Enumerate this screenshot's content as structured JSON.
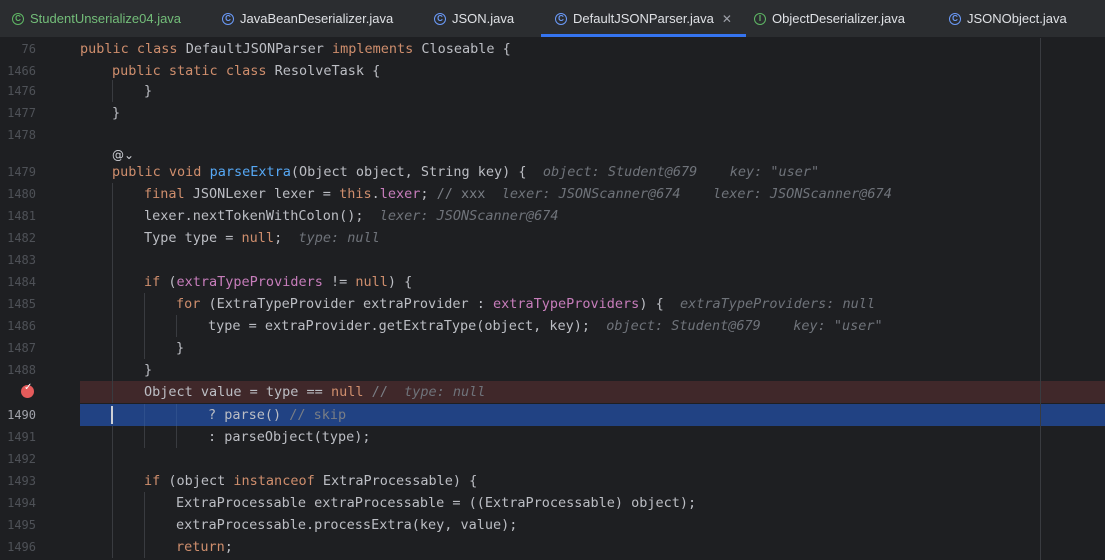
{
  "tabs": [
    {
      "label": "StudentUnserialize04.java",
      "icon": "class-run-icon",
      "active": false,
      "green": true
    },
    {
      "label": "JavaBeanDeserializer.java",
      "icon": "class-icon",
      "active": false
    },
    {
      "label": "JSON.java",
      "icon": "class-icon",
      "active": false
    },
    {
      "label": "DefaultJSONParser.java",
      "icon": "class-icon",
      "active": true,
      "close": "✕"
    },
    {
      "label": "ObjectDeserializer.java",
      "icon": "interface-icon",
      "active": false
    },
    {
      "label": "JSONObject.java",
      "icon": "class-icon",
      "active": false
    }
  ],
  "lines": [
    {
      "num": "76"
    },
    {
      "num": "1466"
    },
    {
      "num": "1476"
    },
    {
      "num": "1477"
    },
    {
      "num": "1478"
    },
    {
      "num": "1479"
    },
    {
      "num": "1480"
    },
    {
      "num": "1481"
    },
    {
      "num": "1482"
    },
    {
      "num": "1483"
    },
    {
      "num": "1484"
    },
    {
      "num": "1485"
    },
    {
      "num": "1486"
    },
    {
      "num": "1487"
    },
    {
      "num": "1488"
    },
    {
      "num": ""
    },
    {
      "num": "1490"
    },
    {
      "num": "1491"
    },
    {
      "num": "1492"
    },
    {
      "num": "1493"
    },
    {
      "num": "1494"
    },
    {
      "num": "1495"
    },
    {
      "num": "1496"
    }
  ],
  "code": {
    "l76": [
      "public",
      " ",
      "class",
      " DefaultJSONParser ",
      "implements",
      " Closeable {"
    ],
    "l1466": [
      "public",
      " ",
      "static",
      " ",
      "class",
      " ResolveTask {"
    ],
    "l1476": "}",
    "l1477": "}",
    "lens_icon": "@",
    "lens_chevron": "⌄",
    "l1479": {
      "kw1": "public",
      "kw2": "void",
      "fn": "parseExtra",
      "rest": "(Object object, String key) {",
      "hint": "object: Student@679    key: \"user\""
    },
    "l1480": {
      "kw": "final",
      "a": " JSONLexer lexer = ",
      "kw2": "this",
      "b": ".",
      "fld": "lexer",
      "c": "; ",
      "cmt": "// xxx",
      "hint": "lexer: JSONScanner@674    lexer: JSONScanner@674"
    },
    "l1481": {
      "a": "lexer.nextTokenWithColon();",
      "hint": "lexer: JSONScanner@674"
    },
    "l1482": {
      "a": "Type type = ",
      "kw": "null",
      "b": ";",
      "hint": "type: null"
    },
    "l1484": {
      "kw": "if",
      "a": " (",
      "fld": "extraTypeProviders",
      "b": " != ",
      "kw2": "null",
      "c": ") {"
    },
    "l1485": {
      "kw": "for",
      "a": " (ExtraTypeProvider extraProvider : ",
      "fld": "extraTypeProviders",
      "b": ") {",
      "hint": "extraTypeProviders: null"
    },
    "l1486": {
      "a": "type = extraProvider.getExtraType(object, key);",
      "hint": "object: Student@679    key: \"user\""
    },
    "l1487": "}",
    "l1488": "}",
    "l1489": {
      "a": "Object value = type == ",
      "kw": "null",
      "b": " ",
      "cmt": "//",
      "hint": "type: null"
    },
    "l1490": {
      "a": "? parse() ",
      "cmt": "// skip"
    },
    "l1491": {
      "a": ": parseObject(type);"
    },
    "l1493": {
      "kw": "if",
      "a": " (object ",
      "kw2": "instanceof",
      "b": " ExtraProcessable) {"
    },
    "l1494": {
      "a": "ExtraProcessable extraProcessable = ((ExtraProcessable) object);"
    },
    "l1495": {
      "a": "extraProcessable.processExtra(key, value);"
    },
    "l1496": {
      "kw": "return",
      "a": ";"
    }
  }
}
